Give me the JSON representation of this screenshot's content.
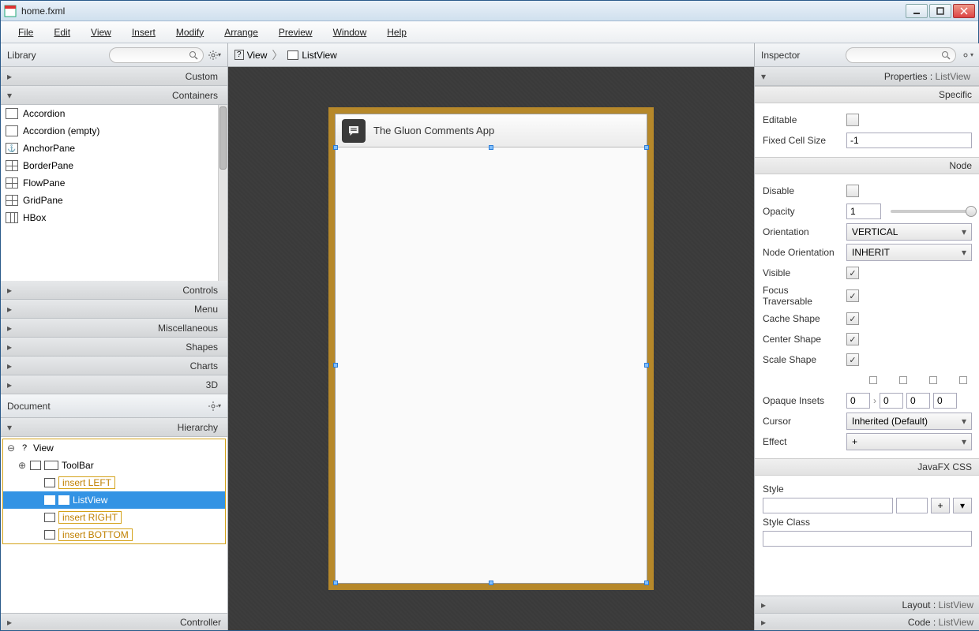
{
  "window": {
    "title": "home.fxml"
  },
  "menubar": [
    "File",
    "Edit",
    "View",
    "Insert",
    "Modify",
    "Arrange",
    "Preview",
    "Window",
    "Help"
  ],
  "library": {
    "title": "Library",
    "sections": {
      "custom": "Custom",
      "containers": "Containers",
      "controls": "Controls",
      "menu": "Menu",
      "misc": "Miscellaneous",
      "shapes": "Shapes",
      "charts": "Charts",
      "threeD": "3D"
    },
    "items": [
      "Accordion",
      "Accordion  (empty)",
      "AnchorPane",
      "BorderPane",
      "FlowPane",
      "GridPane",
      "HBox"
    ]
  },
  "document": {
    "title": "Document",
    "section": "Hierarchy",
    "controller": "Controller",
    "tree": {
      "root": "View",
      "toolbar": "ToolBar",
      "left": "insert LEFT",
      "listview": "ListView",
      "right": "insert RIGHT",
      "bottom": "insert BOTTOM"
    }
  },
  "breadcrumb": {
    "view": "View",
    "listview": "ListView"
  },
  "preview": {
    "title": "The Gluon Comments App"
  },
  "inspector": {
    "title": "Inspector",
    "header": {
      "label": "Properties",
      "target": "ListView"
    },
    "sections": {
      "specific": "Specific",
      "node": "Node",
      "javafx_css": "JavaFX CSS"
    },
    "props": {
      "editable": "Editable",
      "fixed_cell_size": {
        "label": "Fixed Cell Size",
        "value": "-1"
      },
      "disable": "Disable",
      "opacity": {
        "label": "Opacity",
        "value": "1"
      },
      "orientation": {
        "label": "Orientation",
        "value": "VERTICAL"
      },
      "node_orientation": {
        "label": "Node Orientation",
        "value": "INHERIT"
      },
      "visible": "Visible",
      "focus_traversable": "Focus Traversable",
      "cache_shape": "Cache Shape",
      "center_shape": "Center Shape",
      "scale_shape": "Scale Shape",
      "opaque_insets": {
        "label": "Opaque Insets",
        "v": [
          "0",
          "0",
          "0",
          "0"
        ]
      },
      "cursor": {
        "label": "Cursor",
        "value": "Inherited (Default)"
      },
      "effect": {
        "label": "Effect",
        "value": "+"
      },
      "style": "Style",
      "style_class": "Style Class"
    },
    "footers": {
      "layout": {
        "label": "Layout",
        "target": "ListView"
      },
      "code": {
        "label": "Code",
        "target": "ListView"
      }
    }
  }
}
